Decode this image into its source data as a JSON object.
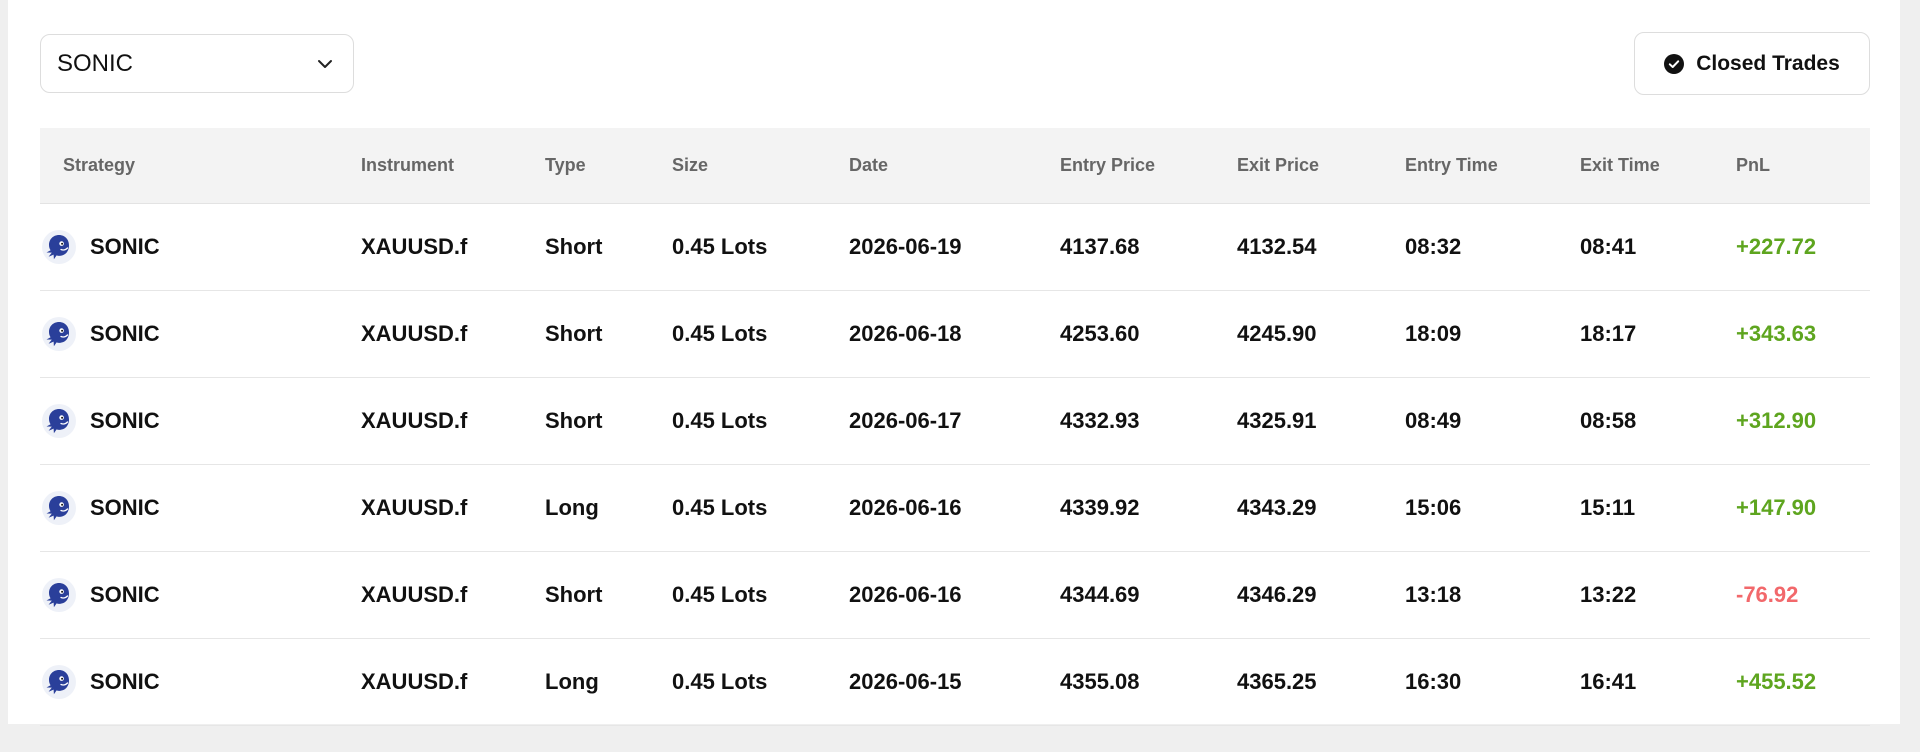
{
  "filter": {
    "selected": "SONIC"
  },
  "closed_trades_button": {
    "label": "Closed Trades"
  },
  "colors": {
    "profit": "#5ea51f",
    "loss": "#f2686b",
    "logo": "#2a3f9a"
  },
  "table": {
    "headers": [
      "Strategy",
      "Instrument",
      "Type",
      "Size",
      "Date",
      "Entry Price",
      "Exit Price",
      "Entry Time",
      "Exit Time",
      "PnL"
    ],
    "rows": [
      {
        "strategy": "SONIC",
        "instrument": "XAUUSD.f",
        "type": "Short",
        "size": "0.45 Lots",
        "date": "2026-06-19",
        "entry_price": "4137.68",
        "exit_price": "4132.54",
        "entry_time": "08:32",
        "exit_time": "08:41",
        "pnl": "+227.72"
      },
      {
        "strategy": "SONIC",
        "instrument": "XAUUSD.f",
        "type": "Short",
        "size": "0.45 Lots",
        "date": "2026-06-18",
        "entry_price": "4253.60",
        "exit_price": "4245.90",
        "entry_time": "18:09",
        "exit_time": "18:17",
        "pnl": "+343.63"
      },
      {
        "strategy": "SONIC",
        "instrument": "XAUUSD.f",
        "type": "Short",
        "size": "0.45 Lots",
        "date": "2026-06-17",
        "entry_price": "4332.93",
        "exit_price": "4325.91",
        "entry_time": "08:49",
        "exit_time": "08:58",
        "pnl": "+312.90"
      },
      {
        "strategy": "SONIC",
        "instrument": "XAUUSD.f",
        "type": "Long",
        "size": "0.45 Lots",
        "date": "2026-06-16",
        "entry_price": "4339.92",
        "exit_price": "4343.29",
        "entry_time": "15:06",
        "exit_time": "15:11",
        "pnl": "+147.90"
      },
      {
        "strategy": "SONIC",
        "instrument": "XAUUSD.f",
        "type": "Short",
        "size": "0.45 Lots",
        "date": "2026-06-16",
        "entry_price": "4344.69",
        "exit_price": "4346.29",
        "entry_time": "13:18",
        "exit_time": "13:22",
        "pnl": "-76.92"
      },
      {
        "strategy": "SONIC",
        "instrument": "XAUUSD.f",
        "type": "Long",
        "size": "0.45 Lots",
        "date": "2026-06-15",
        "entry_price": "4355.08",
        "exit_price": "4365.25",
        "entry_time": "16:30",
        "exit_time": "16:41",
        "pnl": "+455.52"
      }
    ]
  }
}
